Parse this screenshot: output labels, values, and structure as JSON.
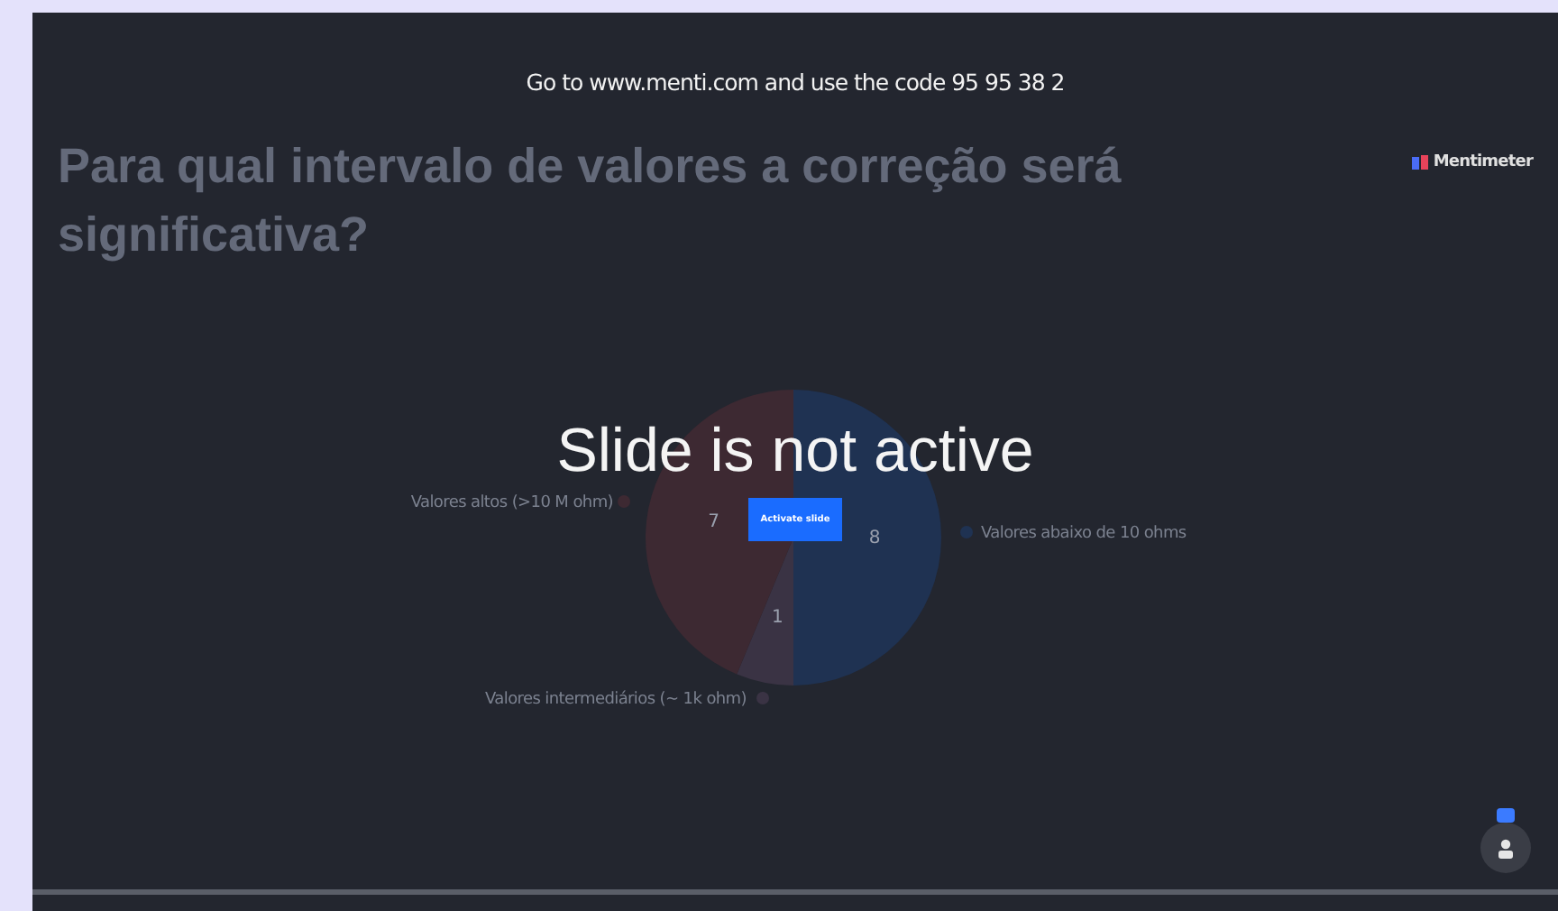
{
  "join_instructions": "Go to www.menti.com and use the code 95 95 38 2",
  "question": "Para qual intervalo de valores a correção será significativa?",
  "brand": "Mentimeter",
  "overlay": {
    "message": "Slide is not active",
    "button": "Activate slide"
  },
  "chart_data": {
    "type": "pie",
    "categories": [
      "Valores abaixo de 10 ohms",
      "Valores intermediários (~ 1k ohm)",
      "Valores altos (>10 M ohm)"
    ],
    "series": [
      {
        "values": [
          8,
          1,
          7
        ]
      }
    ],
    "legend": true,
    "colors": [
      "#1f3252",
      "#3a3344",
      "#3d2932"
    ],
    "data_labels": true
  }
}
